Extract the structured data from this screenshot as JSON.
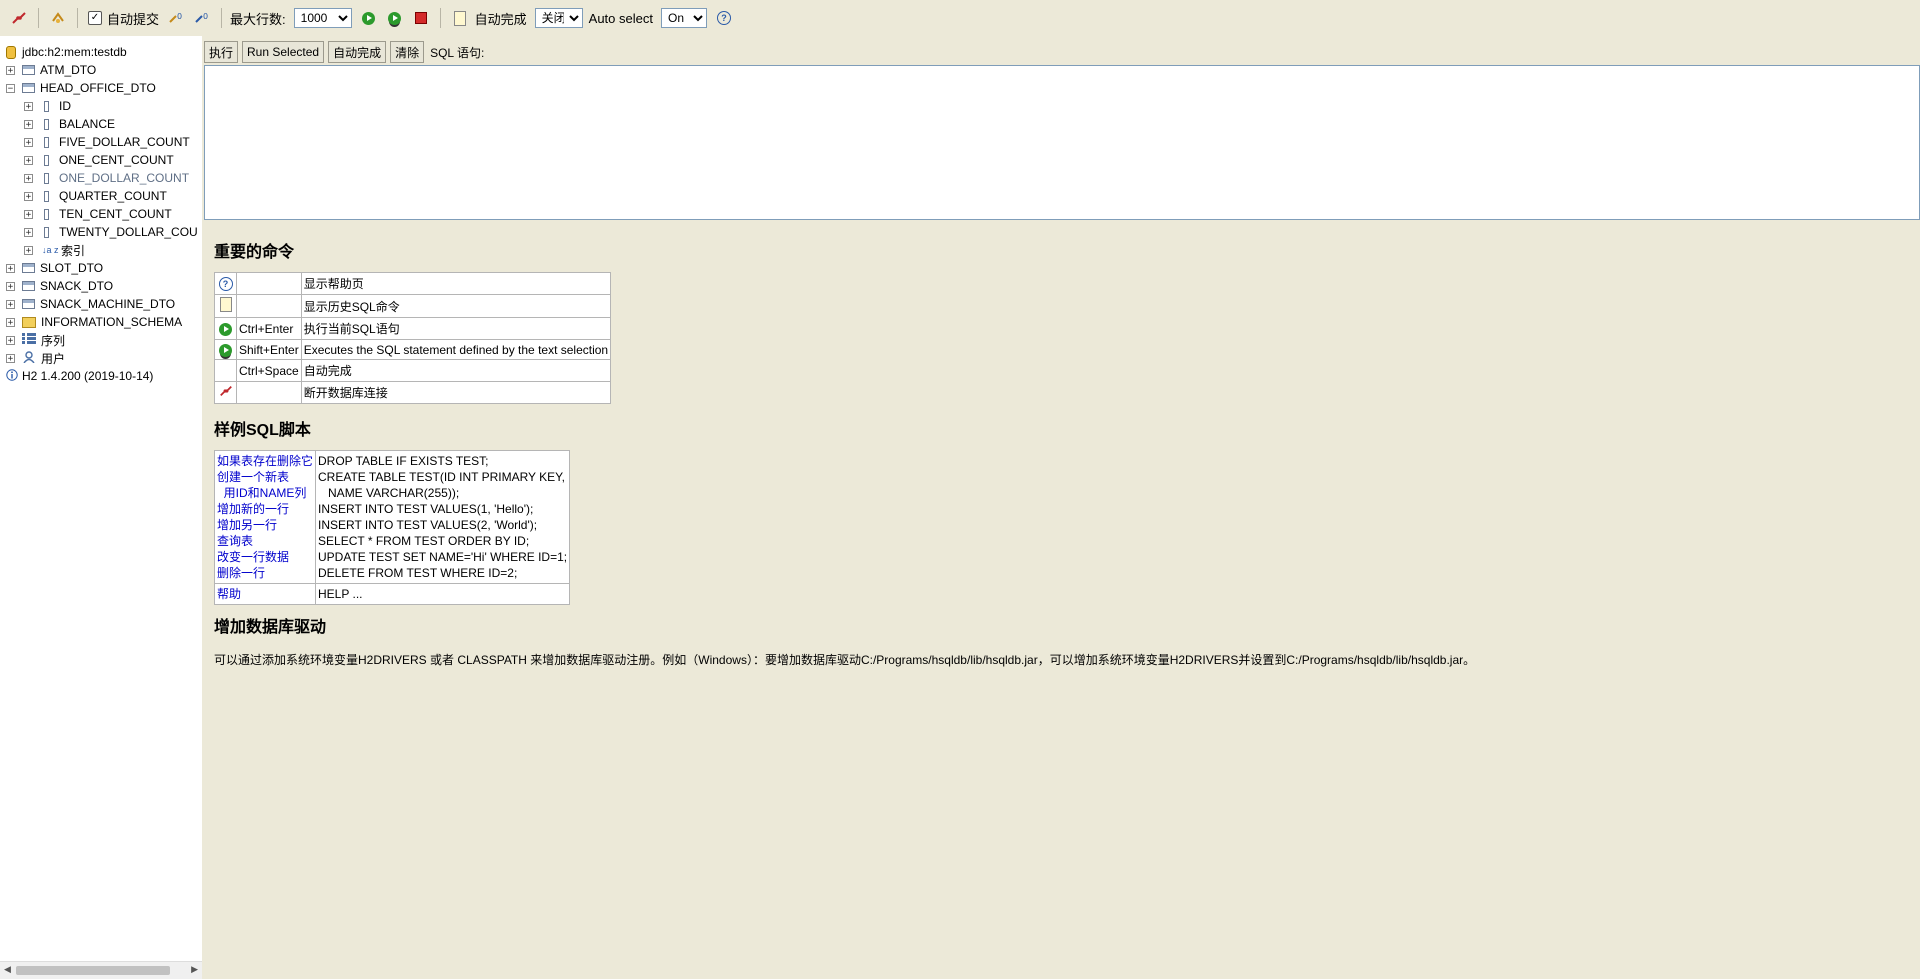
{
  "toolbar": {
    "autocommit_label": "自动提交",
    "autocommit_checked": true,
    "maxrows_label": "最大行数:",
    "maxrows_value": "1000",
    "autocomplete_label": "自动完成",
    "autocomplete_value": "关闭",
    "autoselect_label": "Auto select",
    "autoselect_value": "On",
    "help_glyph": "?"
  },
  "sidebar": {
    "connection": "jdbc:h2:mem:testdb",
    "items": [
      {
        "label": "ATM_DTO",
        "expander": "+"
      },
      {
        "label": "HEAD_OFFICE_DTO",
        "expander": "−"
      },
      {
        "label": "ID",
        "expander": "+"
      },
      {
        "label": "BALANCE",
        "expander": "+"
      },
      {
        "label": "FIVE_DOLLAR_COUNT",
        "expander": "+"
      },
      {
        "label": "ONE_CENT_COUNT",
        "expander": "+"
      },
      {
        "label": "ONE_DOLLAR_COUNT",
        "expander": "+"
      },
      {
        "label": "QUARTER_COUNT",
        "expander": "+"
      },
      {
        "label": "TEN_CENT_COUNT",
        "expander": "+"
      },
      {
        "label": "TWENTY_DOLLAR_COU",
        "expander": "+"
      },
      {
        "label": "索引",
        "expander": "+"
      },
      {
        "label": "SLOT_DTO",
        "expander": "+"
      },
      {
        "label": "SNACK_DTO",
        "expander": "+"
      },
      {
        "label": "SNACK_MACHINE_DTO",
        "expander": "+"
      },
      {
        "label": "INFORMATION_SCHEMA",
        "expander": "+"
      },
      {
        "label": "序列",
        "expander": "+"
      },
      {
        "label": "用户",
        "expander": "+"
      },
      {
        "label": "H2 1.4.200 (2019-10-14)",
        "expander": ""
      }
    ],
    "index_icon_glyph": "↓a z"
  },
  "sql": {
    "execute_label": "执行",
    "run_selected_label": "Run Selected",
    "autocomplete_label": "自动完成",
    "clear_label": "清除",
    "sql_label": "SQL 语句:"
  },
  "help": {
    "commands_title": "重要的命令",
    "commands": [
      {
        "shortcut": "",
        "description": "显示帮助页"
      },
      {
        "shortcut": "",
        "description": "显示历史SQL命令"
      },
      {
        "shortcut": "Ctrl+Enter",
        "description": "执行当前SQL语句"
      },
      {
        "shortcut": "Shift+Enter",
        "description": "Executes the SQL statement defined by the text selection"
      },
      {
        "shortcut": "Ctrl+Space",
        "description": "自动完成"
      },
      {
        "shortcut": "",
        "description": "断开数据库连接"
      }
    ],
    "samples_title": "样例SQL脚本",
    "samples_left": [
      "如果表存在删除它",
      "创建一个新表",
      "  用ID和NAME列",
      "增加新的一行",
      "增加另一行",
      "查询表",
      "改变一行数据",
      "删除一行"
    ],
    "samples_right": [
      "DROP TABLE IF EXISTS TEST;",
      "CREATE TABLE TEST(ID INT PRIMARY KEY,",
      "   NAME VARCHAR(255));",
      "INSERT INTO TEST VALUES(1, 'Hello');",
      "INSERT INTO TEST VALUES(2, 'World');",
      "SELECT * FROM TEST ORDER BY ID;",
      "UPDATE TEST SET NAME='Hi' WHERE ID=1;",
      "DELETE FROM TEST WHERE ID=2;"
    ],
    "help_link": "帮助",
    "help_cmd": "HELP ...",
    "driver_title": "增加数据库驱动",
    "driver_text": "可以通过添加系统环境变量H2DRIVERS 或者 CLASSPATH 来增加数据库驱动注册。例如（Windows）：要增加数据库驱动C:/Programs/hsqldb/lib/hsqldb.jar，可以增加系统环境变量H2DRIVERS并设置到C:/Programs/hsqldb/lib/hsqldb.jar。"
  }
}
